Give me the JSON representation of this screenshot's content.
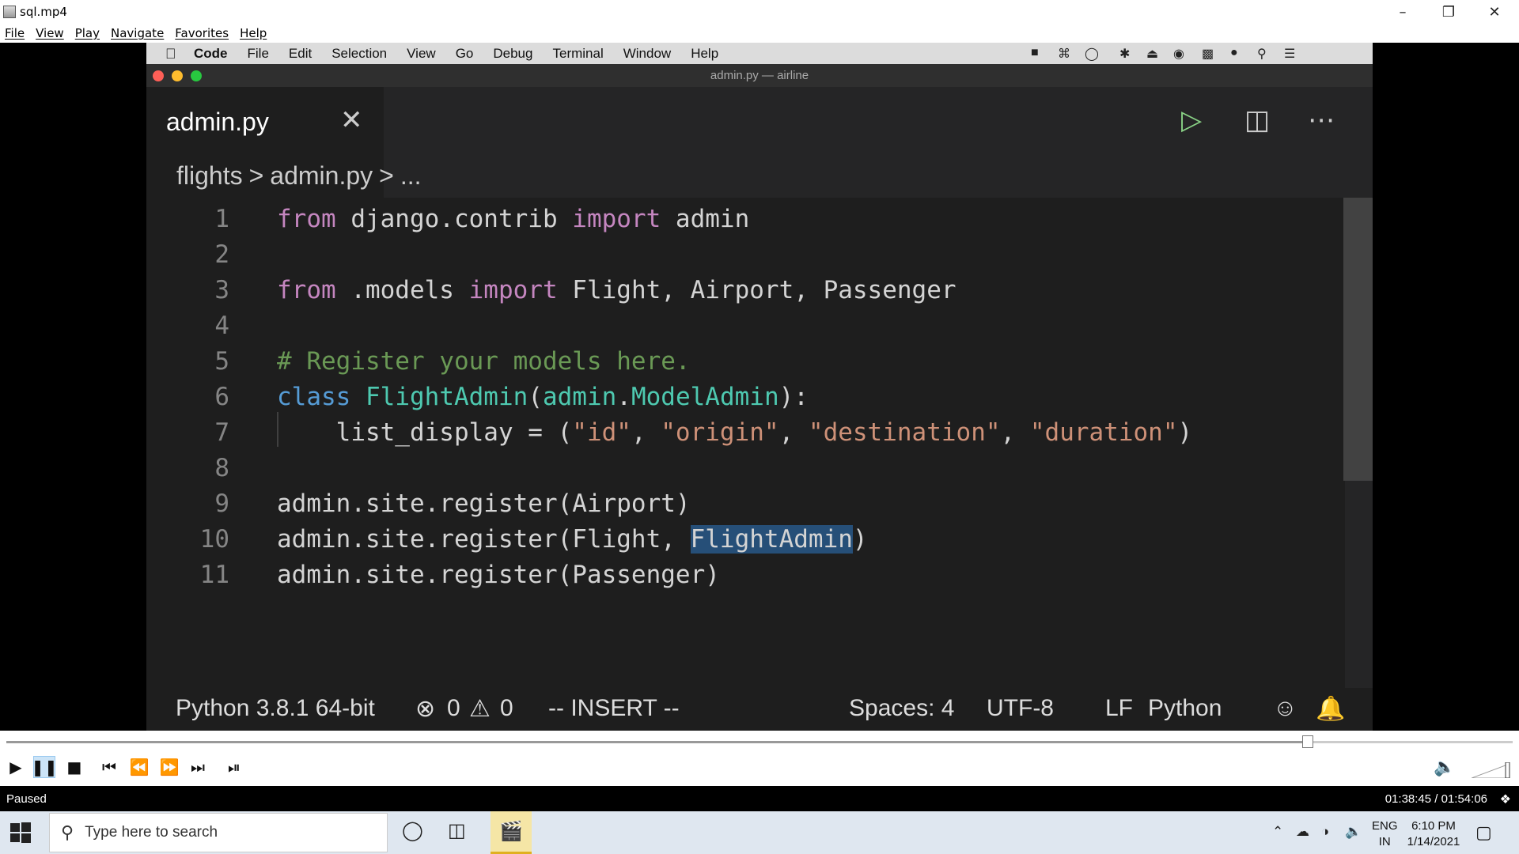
{
  "window": {
    "title": "sql.mp4",
    "menu": [
      "File",
      "View",
      "Play",
      "Navigate",
      "Favorites",
      "Help"
    ]
  },
  "mac": {
    "menu": [
      "Code",
      "File",
      "Edit",
      "Selection",
      "View",
      "Go",
      "Debug",
      "Terminal",
      "Window",
      "Help"
    ],
    "window_title": "admin.py — airline"
  },
  "editor": {
    "tab_label": "admin.py",
    "breadcrumb": [
      "flights",
      ">",
      "admin.py",
      ">",
      "..."
    ],
    "line_numbers": [
      "1",
      "2",
      "3",
      "4",
      "5",
      "6",
      "7",
      "8",
      "9",
      "10",
      "11"
    ],
    "lines": {
      "l1": {
        "a": "from",
        "b": " django.contrib ",
        "c": "import",
        "d": " admin"
      },
      "l3": {
        "a": "from",
        "b": " .models ",
        "c": "import",
        "d": " Flight, Airport, Passenger"
      },
      "l5": {
        "a": "# Register your models here."
      },
      "l6": {
        "a": "class",
        "b": " ",
        "c": "FlightAdmin",
        "d": "(",
        "e": "admin",
        "f": ".",
        "g": "ModelAdmin",
        "h": "):"
      },
      "l7": {
        "a": "    list_display = (",
        "b": "\"id\"",
        "c": ", ",
        "d": "\"origin\"",
        "e": ", ",
        "f": "\"destination\"",
        "g": ", ",
        "h": "\"duration\"",
        "i": ")"
      },
      "l9": {
        "a": "admin.site.register(Airport)"
      },
      "l10": {
        "a": "admin.site.register(Flight, ",
        "b": "FlightAdmin",
        "c": ")"
      },
      "l11": {
        "a": "admin.site.register(Passenger)"
      }
    },
    "status": {
      "interpreter": "Python 3.8.1 64-bit",
      "errors": "0",
      "warnings": "0",
      "mode": "-- INSERT --",
      "spaces": "Spaces: 4",
      "encoding": "UTF-8",
      "eol": "LF",
      "language": "Python"
    }
  },
  "player": {
    "progress_fraction": 0.864,
    "state": "Paused",
    "time": "01:38:45 / 01:54:06"
  },
  "taskbar": {
    "search_placeholder": "Type here to search",
    "lang_top": "ENG",
    "lang_bottom": "IN",
    "time": "6:10 PM",
    "date": "1/14/2021"
  }
}
